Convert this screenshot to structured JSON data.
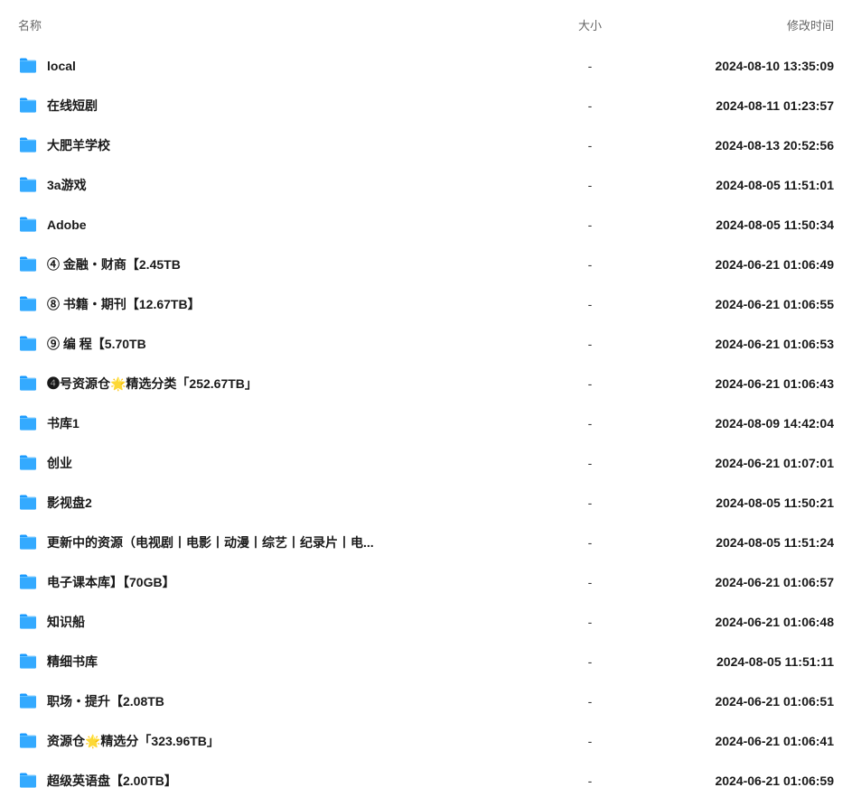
{
  "headers": {
    "name": "名称",
    "size": "大小",
    "date": "修改时间"
  },
  "rows": [
    {
      "name": "local",
      "size": "-",
      "date": "2024-08-10 13:35:09"
    },
    {
      "name": "在线短剧",
      "size": "-",
      "date": "2024-08-11 01:23:57"
    },
    {
      "name": "大肥羊学校",
      "size": "-",
      "date": "2024-08-13 20:52:56"
    },
    {
      "name": "3a游戏",
      "size": "-",
      "date": "2024-08-05 11:51:01"
    },
    {
      "name": "Adobe",
      "size": "-",
      "date": "2024-08-05 11:50:34"
    },
    {
      "name": "④ 金融・财商【2.45TB",
      "size": "-",
      "date": "2024-06-21 01:06:49"
    },
    {
      "name": "⑧ 书籍・期刊【12.67TB】",
      "size": "-",
      "date": "2024-06-21 01:06:55"
    },
    {
      "name": "⑨ 编 程【5.70TB",
      "size": "-",
      "date": "2024-06-21 01:06:53"
    },
    {
      "name": "❹号资源仓🌟精选分类「252.67TB」",
      "size": "-",
      "date": "2024-06-21 01:06:43"
    },
    {
      "name": "书库1",
      "size": "-",
      "date": "2024-08-09 14:42:04"
    },
    {
      "name": "创业",
      "size": "-",
      "date": "2024-06-21 01:07:01"
    },
    {
      "name": "影视盘2",
      "size": "-",
      "date": "2024-08-05 11:50:21"
    },
    {
      "name": "更新中的资源（电视剧丨电影丨动漫丨综艺丨纪录片丨电...",
      "size": "-",
      "date": "2024-08-05 11:51:24"
    },
    {
      "name": "电子课本库】【70GB】",
      "size": "-",
      "date": "2024-06-21 01:06:57"
    },
    {
      "name": "知识船",
      "size": "-",
      "date": "2024-06-21 01:06:48"
    },
    {
      "name": "精细书库",
      "size": "-",
      "date": "2024-08-05 11:51:11"
    },
    {
      "name": "职场・提升【2.08TB",
      "size": "-",
      "date": "2024-06-21 01:06:51"
    },
    {
      "name": "资源仓🌟精选分「323.96TB」",
      "size": "-",
      "date": "2024-06-21 01:06:41"
    },
    {
      "name": "超级英语盘【2.00TB】",
      "size": "-",
      "date": "2024-06-21 01:06:59"
    }
  ]
}
